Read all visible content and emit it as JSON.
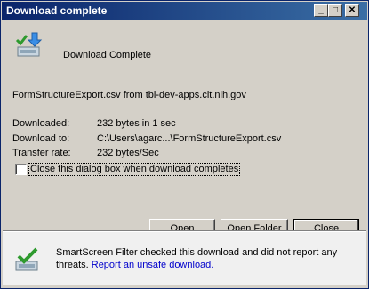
{
  "window": {
    "title": "Download complete"
  },
  "title_buttons": {
    "minimize": "_",
    "maximize": "□",
    "close": "✕"
  },
  "header": {
    "label": "Download Complete"
  },
  "file_line": "FormStructureExport.csv from tbi-dev-apps.cit.nih.gov",
  "details": [
    {
      "label": "Downloaded:",
      "value": "232 bytes in 1 sec"
    },
    {
      "label": "Download to:",
      "value": "C:\\Users\\agarc...\\FormStructureExport.csv"
    },
    {
      "label": "Transfer rate:",
      "value": "232 bytes/Sec"
    }
  ],
  "checkbox": {
    "label": "Close this dialog box when download completes",
    "checked": false
  },
  "buttons": {
    "open": "Open",
    "open_folder": "Open Folder",
    "close": "Close"
  },
  "smartscreen": {
    "text": "SmartScreen Filter checked this download and did not report any threats.",
    "link": "Report an unsafe download."
  }
}
